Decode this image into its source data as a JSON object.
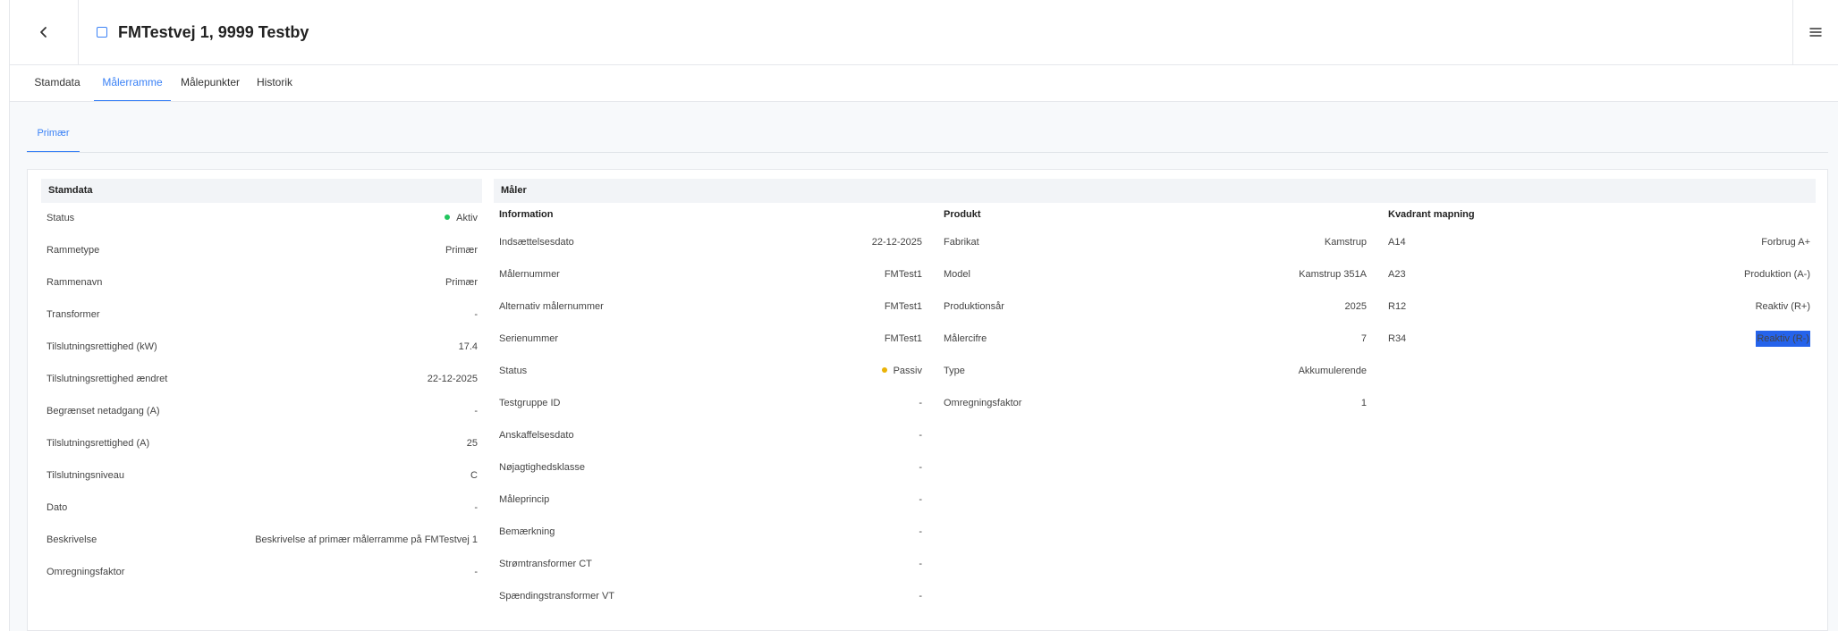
{
  "header": {
    "title": "FMTestvej 1, 9999 Testby",
    "back_icon": "chevron-left-icon",
    "menu_icon": "hamburger-menu-icon"
  },
  "tabs": [
    {
      "label": "Stamdata",
      "active": false
    },
    {
      "label": "Målerramme",
      "active": true
    },
    {
      "label": "Målepunkter",
      "active": false
    },
    {
      "label": "Historik",
      "active": false
    }
  ],
  "subtabs": [
    {
      "label": "Primær",
      "active": true
    }
  ],
  "stamdata": {
    "heading": "Stamdata",
    "rows": [
      {
        "label": "Status",
        "value": "Aktiv",
        "status_color": "#22c55e"
      },
      {
        "label": "Rammetype",
        "value": "Primær"
      },
      {
        "label": "Rammenavn",
        "value": "Primær"
      },
      {
        "label": "Transformer",
        "value": "-"
      },
      {
        "label": "Tilslutningsrettighed (kW)",
        "value": "17.4"
      },
      {
        "label": "Tilslutningsrettighed ændret",
        "value": "22-12-2025"
      },
      {
        "label": "Begrænset netadgang (A)",
        "value": "-"
      },
      {
        "label": "Tilslutningsrettighed (A)",
        "value": "25"
      },
      {
        "label": "Tilslutningsniveau",
        "value": "C"
      },
      {
        "label": "Dato",
        "value": "-"
      },
      {
        "label": "Beskrivelse",
        "value": "Beskrivelse af primær målerramme på FMTestvej 1"
      },
      {
        "label": "Omregningsfaktor",
        "value": "-"
      }
    ]
  },
  "maaler": {
    "heading": "Måler",
    "information": {
      "title": "Information",
      "rows": [
        {
          "label": "Indsættelsesdato",
          "value": "22-12-2025"
        },
        {
          "label": "Målernummer",
          "value": "FMTest1"
        },
        {
          "label": "Alternativ målernummer",
          "value": "FMTest1"
        },
        {
          "label": "Serienummer",
          "value": "FMTest1"
        },
        {
          "label": "Status",
          "value": "Passiv",
          "status_color": "#eab308"
        },
        {
          "label": "Testgruppe ID",
          "value": "-"
        },
        {
          "label": "Anskaffelsesdato",
          "value": "-"
        },
        {
          "label": "Nøjagtighedsklasse",
          "value": "-"
        },
        {
          "label": "Måleprincip",
          "value": "-"
        },
        {
          "label": "Bemærkning",
          "value": "-"
        },
        {
          "label": "Strømtransformer CT",
          "value": "-"
        },
        {
          "label": "Spændingstransformer VT",
          "value": "-"
        }
      ]
    },
    "produkt": {
      "title": "Produkt",
      "rows": [
        {
          "label": "Fabrikat",
          "value": "Kamstrup"
        },
        {
          "label": "Model",
          "value": "Kamstrup 351A"
        },
        {
          "label": "Produktionsår",
          "value": "2025"
        },
        {
          "label": "Målercifre",
          "value": "7"
        },
        {
          "label": "Type",
          "value": "Akkumulerende"
        },
        {
          "label": "Omregningsfaktor",
          "value": "1"
        }
      ]
    },
    "kvadrant": {
      "title": "Kvadrant mapning",
      "rows": [
        {
          "label": "A14",
          "value": "Forbrug A+"
        },
        {
          "label": "A23",
          "value": "Produktion (A-)"
        },
        {
          "label": "R12",
          "value": "Reaktiv (R+)"
        },
        {
          "label": "R34",
          "value": "Reaktiv (R-)",
          "selected": true
        }
      ]
    }
  }
}
